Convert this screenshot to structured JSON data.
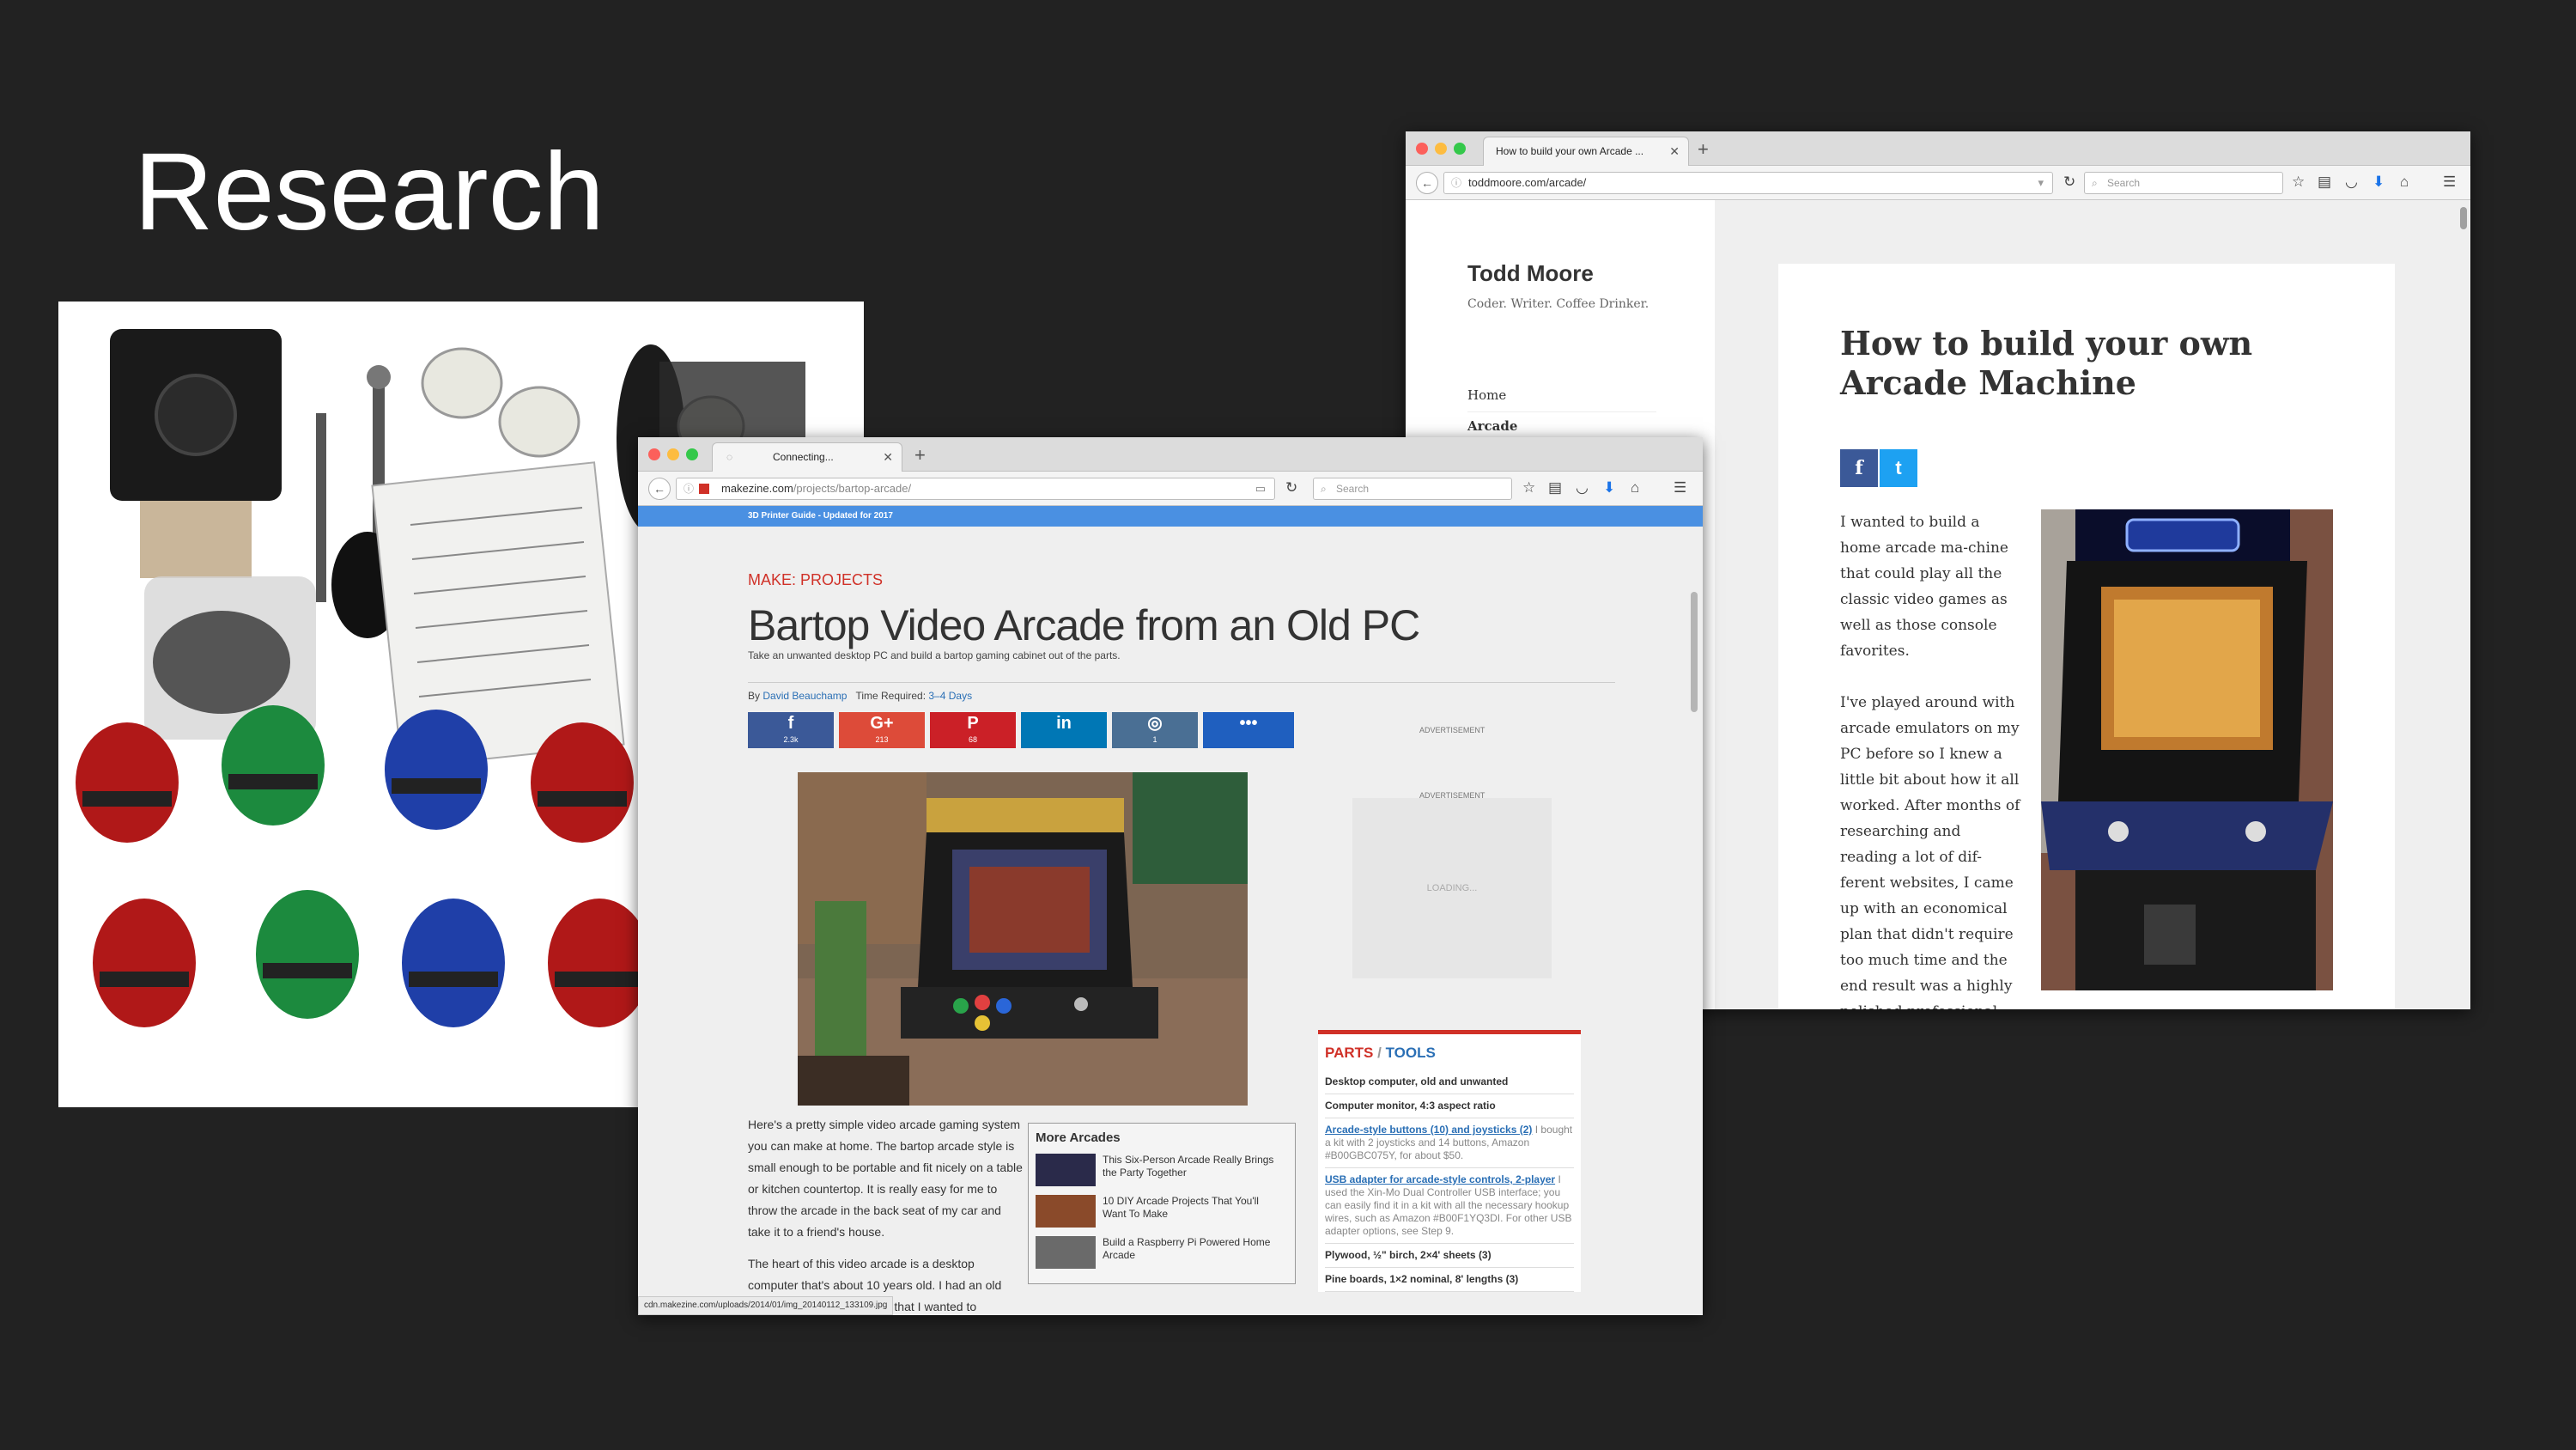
{
  "slide": {
    "title": "Research"
  },
  "todd_browser": {
    "tab_title": "How to build your own Arcade ...",
    "url": "toddmoore.com/arcade/",
    "search_placeholder": "Search",
    "site_title": "Todd Moore",
    "site_tagline": "Coder. Writer. Coffee Drinker.",
    "nav": [
      "Home",
      "Arcade"
    ],
    "article_title": "How to build your own Arcade Machine",
    "share": [
      "f",
      "t"
    ],
    "paragraphs": [
      "I wanted to build a home arcade ma-chine that could play all the classic video games as well as those console favorites.",
      "I've played around with arcade emulators on my PC before so I knew a little bit about how it all worked. After months of researching and reading a lot of dif-ferent websites, I came up with an economical plan that didn't require too much time and the end result was a highly polished professional"
    ]
  },
  "make_browser": {
    "tab_title": "Connecting...",
    "url_domain": "makezine.com",
    "url_path": "/projects/bartop-arcade/",
    "search_placeholder": "Search",
    "promo_bar": "3D Printer Guide - Updated for 2017",
    "kicker": "MAKE: PROJECTS",
    "title": "Bartop Video Arcade from an Old PC",
    "subtitle": "Take an unwanted desktop PC and build a bartop gaming cabinet out of the parts.",
    "byline_by": "By",
    "author": "David Beauchamp",
    "time_label": "Time Required:",
    "time_value": "3–4 Days",
    "share_buttons": [
      {
        "glyph": "f",
        "count": "2.3k",
        "color": "#3b5998"
      },
      {
        "glyph": "G+",
        "count": "213",
        "color": "#dd4b39"
      },
      {
        "glyph": "P",
        "count": "68",
        "color": "#cb2027"
      },
      {
        "glyph": "in",
        "count": "",
        "color": "#0077b5"
      },
      {
        "glyph": "◎",
        "count": "1",
        "color": "#4a6f94"
      },
      {
        "glyph": "•••",
        "count": "",
        "color": "#1f5fbf"
      }
    ],
    "ad_label_1": "ADVERTISEMENT",
    "ad_label_2": "ADVERTISEMENT",
    "ad_loading": "LOADING...",
    "body_paragraphs": [
      "Here's a pretty simple video arcade gaming system you can make at home. The bartop arcade style is small enough to be portable and fit nicely on a table or kitchen countertop. It is really easy for me to throw the arcade in the back seat of my car and take it to a friend's house.",
      "The heart of this video arcade is a desktop computer that's about 10 years old. I had an old Gateway PC sitting around that I wanted to"
    ],
    "more_arcades": {
      "title": "More Arcades",
      "items": [
        "This Six-Person Arcade Really Brings the Party Together",
        "10 DIY Arcade Projects That You'll Want To Make",
        "Build a Raspberry Pi Powered Home Arcade"
      ]
    },
    "parts_tools": {
      "parts": "PARTS",
      "sep": "/",
      "tools": "TOOLS",
      "items": [
        {
          "link": "",
          "text": "Desktop computer, old and unwanted",
          "detail": ""
        },
        {
          "link": "",
          "text": "Computer monitor, 4:3 aspect ratio",
          "detail": ""
        },
        {
          "link": "Arcade-style buttons (10) and joysticks (2)",
          "text": "",
          "detail": "I bought a kit with 2 joysticks and 14 buttons, Amazon #B00GBC075Y, for about $50."
        },
        {
          "link": "USB adapter for arcade-style controls, 2-player",
          "text": "",
          "detail": "I used the Xin-Mo Dual Controller USB interface; you can easily find it in a kit with all the necessary hookup wires, such as Amazon #B00F1YQ3DI. For other USB adapter options, see Step 9."
        },
        {
          "link": "",
          "text": "Plywood, ½\" birch, 2×4' sheets (3)",
          "detail": ""
        },
        {
          "link": "",
          "text": "Pine boards, 1×2 nominal, 8' lengths (3)",
          "detail": ""
        }
      ]
    },
    "status_url": "cdn.makezine.com/uploads/2014/01/img_20140112_133109.jpg"
  }
}
